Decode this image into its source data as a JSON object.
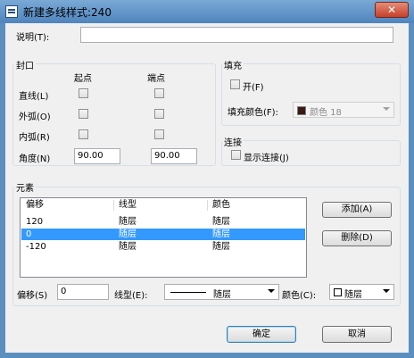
{
  "window": {
    "title": "新建多线样式:240",
    "close_label": "✕"
  },
  "description": {
    "label": "说明(T):",
    "value": ""
  },
  "caps": {
    "group_label": "封口",
    "start_header": "起点",
    "end_header": "端点",
    "rows": [
      {
        "label": "直线(L)",
        "start_checked": false,
        "end_checked": false
      },
      {
        "label": "外弧(O)",
        "start_checked": false,
        "end_checked": false
      },
      {
        "label": "内弧(R)",
        "start_checked": false,
        "end_checked": false
      }
    ],
    "angle_label": "角度(N)",
    "angle_start": "90.00",
    "angle_end": "90.00"
  },
  "fill": {
    "group_label": "填充",
    "on_label": "开(F)",
    "on_checked": false,
    "color_label": "填充颜色(F):",
    "color_value": "颜色 18",
    "swatch_color": "#3b1a12"
  },
  "connect": {
    "group_label": "连接",
    "show_label": "显示连接(J)",
    "checked": false
  },
  "elements": {
    "group_label": "元素",
    "columns": [
      "偏移",
      "线型",
      "颜色"
    ],
    "rows": [
      {
        "offset": "120",
        "linetype": "随层",
        "color": "随层",
        "selected": false
      },
      {
        "offset": "0",
        "linetype": "随层",
        "color": "随层",
        "selected": true
      },
      {
        "offset": "-120",
        "linetype": "随层",
        "color": "随层",
        "selected": false
      }
    ],
    "add_button": "添加(A)",
    "delete_button": "删除(D)",
    "offset_label": "偏移(S)",
    "offset_value": "0",
    "linetype_label": "线型(E):",
    "linetype_value": "随层",
    "color_label": "颜色(C):",
    "color_value": "随层"
  },
  "footer": {
    "ok_button": "确定",
    "cancel_button": "取消"
  },
  "colors": {
    "selection": "#3399ff",
    "title_bar": "#5b8fbf",
    "close_button": "#c6402a"
  }
}
